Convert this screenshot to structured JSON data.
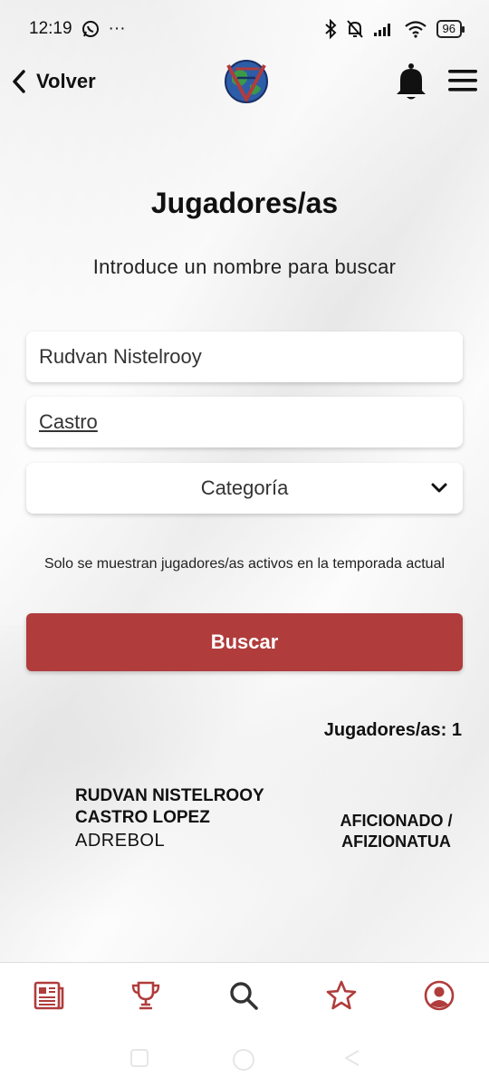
{
  "status_bar": {
    "time": "12:19",
    "dots": "···",
    "battery": "96"
  },
  "header": {
    "back_label": "Volver"
  },
  "page": {
    "title": "Jugadores/as",
    "subtitle": "Introduce un nombre para buscar"
  },
  "form": {
    "name_value": "Rudvan Nistelrooy",
    "surname_value": "Castro",
    "category_label": "Categoría",
    "notice": "Solo se muestran jugadores/as activos en la temporada actual",
    "search_button": "Buscar"
  },
  "results": {
    "count_label": "Jugadores/as: 1",
    "items": [
      {
        "name_line1": "RUDVAN NISTELROOY",
        "name_line2": "CASTRO LOPEZ",
        "club": "ADREBOL",
        "category_line1": "AFICIONADO /",
        "category_line2": "AFIZIONATUA"
      }
    ]
  },
  "bottom_nav": [
    {
      "icon": "news-icon"
    },
    {
      "icon": "trophy-icon"
    },
    {
      "icon": "search-icon"
    },
    {
      "icon": "star-icon"
    },
    {
      "icon": "profile-icon"
    }
  ],
  "colors": {
    "accent": "#b03c3c",
    "active_nav": "#333333"
  }
}
